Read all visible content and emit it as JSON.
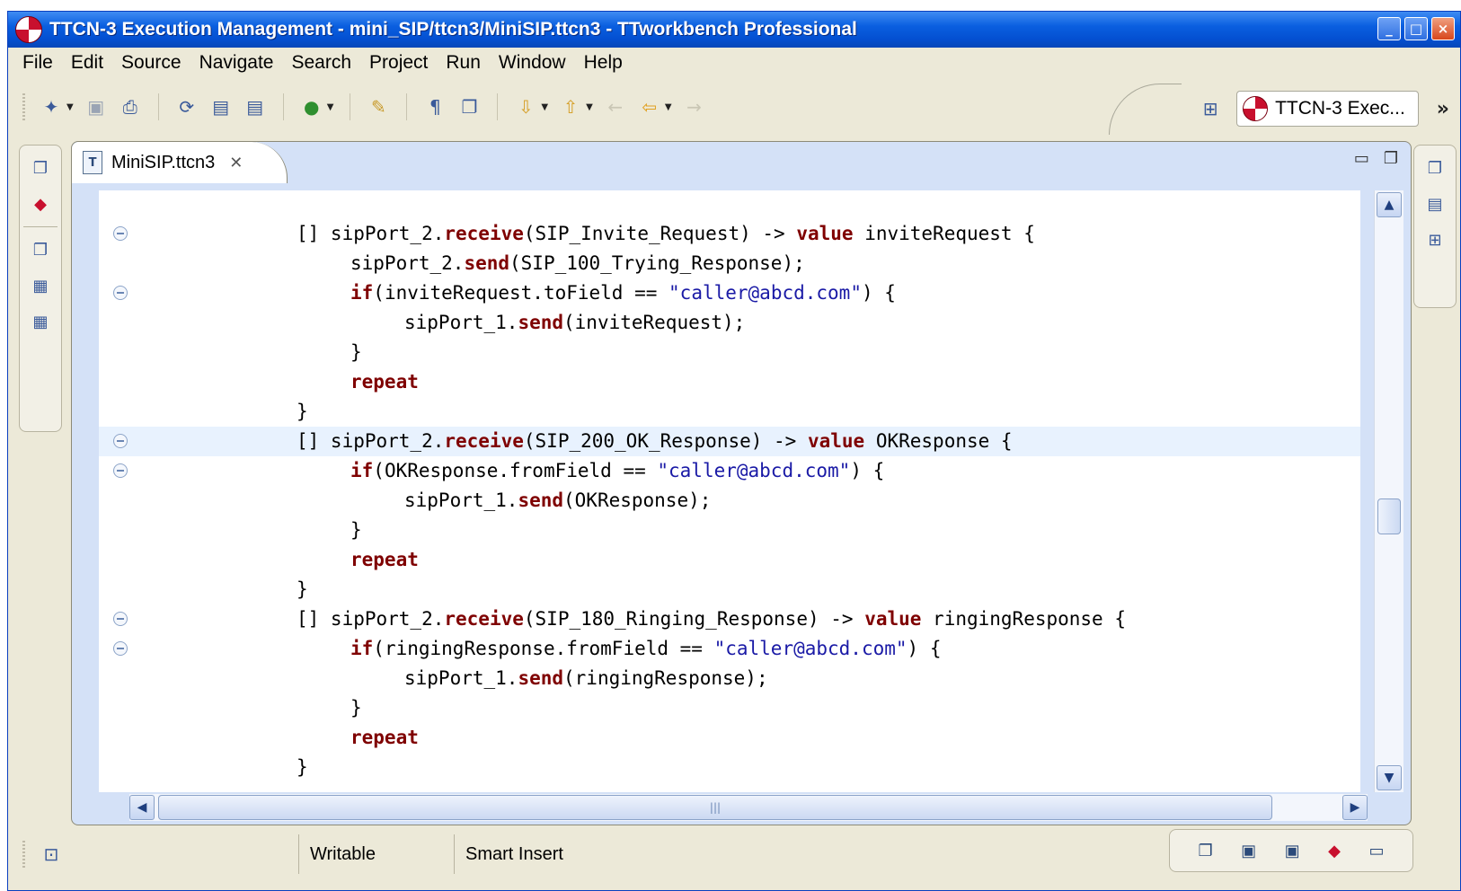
{
  "window": {
    "title": "TTCN-3 Execution Management - mini_SIP/ttcn3/MiniSIP.ttcn3 - TTworkbench Professional",
    "controls": [
      "_",
      "□",
      "×"
    ]
  },
  "menu": [
    "File",
    "Edit",
    "Source",
    "Navigate",
    "Search",
    "Project",
    "Run",
    "Window",
    "Help"
  ],
  "toolbar": {
    "icons": [
      "new-wizard-icon",
      "save-icon",
      "print-icon",
      "refresh-icon",
      "binary-icon",
      "binary-icon",
      "run-icon",
      "pencil-icon",
      "paragraph-icon",
      "copy-icon",
      "next-annotation-icon",
      "prev-annotation-icon",
      "back-icon",
      "back-icon",
      "forward-icon"
    ],
    "perspective_label": "TTCN-3 Exec...",
    "overflow": "»"
  },
  "editor": {
    "tab_label": "MiniSIP.ttcn3",
    "tab_icon": "T",
    "lines": [
      {
        "fold": true,
        "indent": 0,
        "tokens": [
          [
            "t",
            "[] sipPort_2."
          ],
          [
            "k",
            "receive"
          ],
          [
            "t",
            "(SIP_Invite_Request) -> "
          ],
          [
            "k",
            "value"
          ],
          [
            "t",
            " inviteRequest {"
          ]
        ]
      },
      {
        "fold": false,
        "indent": 1,
        "tokens": [
          [
            "t",
            "sipPort_2."
          ],
          [
            "k",
            "send"
          ],
          [
            "t",
            "(SIP_100_Trying_Response);"
          ]
        ]
      },
      {
        "fold": true,
        "indent": 1,
        "tokens": [
          [
            "k",
            "if"
          ],
          [
            "t",
            "(inviteRequest.toField == "
          ],
          [
            "s",
            "\"caller@abcd.com\""
          ],
          [
            "t",
            ") {"
          ]
        ]
      },
      {
        "fold": false,
        "indent": 2,
        "tokens": [
          [
            "t",
            "sipPort_1."
          ],
          [
            "k",
            "send"
          ],
          [
            "t",
            "(inviteRequest);"
          ]
        ]
      },
      {
        "fold": false,
        "indent": 1,
        "tokens": [
          [
            "t",
            "}"
          ]
        ]
      },
      {
        "fold": false,
        "indent": 1,
        "tokens": [
          [
            "k",
            "repeat"
          ]
        ]
      },
      {
        "fold": false,
        "indent": 0,
        "tokens": [
          [
            "t",
            "}"
          ]
        ]
      },
      {
        "fold": true,
        "indent": 0,
        "current": true,
        "tokens": [
          [
            "t",
            "[] sipPort_2."
          ],
          [
            "k",
            "receive"
          ],
          [
            "t",
            "(SIP_200_OK_Response) -> "
          ],
          [
            "k",
            "value"
          ],
          [
            "t",
            " OKResponse {"
          ]
        ]
      },
      {
        "fold": true,
        "indent": 1,
        "tokens": [
          [
            "k",
            "if"
          ],
          [
            "t",
            "(OKResponse.fromField == "
          ],
          [
            "s",
            "\"caller@abcd.com\""
          ],
          [
            "t",
            ") {"
          ]
        ]
      },
      {
        "fold": false,
        "indent": 2,
        "tokens": [
          [
            "t",
            "sipPort_1."
          ],
          [
            "k",
            "send"
          ],
          [
            "t",
            "(OKResponse);"
          ]
        ]
      },
      {
        "fold": false,
        "indent": 1,
        "tokens": [
          [
            "t",
            "}"
          ]
        ]
      },
      {
        "fold": false,
        "indent": 1,
        "tokens": [
          [
            "k",
            "repeat"
          ]
        ]
      },
      {
        "fold": false,
        "indent": 0,
        "tokens": [
          [
            "t",
            "}"
          ]
        ]
      },
      {
        "fold": true,
        "indent": 0,
        "tokens": [
          [
            "t",
            "[] sipPort_2."
          ],
          [
            "k",
            "receive"
          ],
          [
            "t",
            "(SIP_180_Ringing_Response) -> "
          ],
          [
            "k",
            "value"
          ],
          [
            "t",
            " ringingResponse {"
          ]
        ]
      },
      {
        "fold": true,
        "indent": 1,
        "tokens": [
          [
            "k",
            "if"
          ],
          [
            "t",
            "(ringingResponse.fromField == "
          ],
          [
            "s",
            "\"caller@abcd.com\""
          ],
          [
            "t",
            ") {"
          ]
        ]
      },
      {
        "fold": false,
        "indent": 2,
        "tokens": [
          [
            "t",
            "sipPort_1."
          ],
          [
            "k",
            "send"
          ],
          [
            "t",
            "(ringingResponse);"
          ]
        ]
      },
      {
        "fold": false,
        "indent": 1,
        "tokens": [
          [
            "t",
            "}"
          ]
        ]
      },
      {
        "fold": false,
        "indent": 1,
        "tokens": [
          [
            "k",
            "repeat"
          ]
        ]
      },
      {
        "fold": false,
        "indent": 0,
        "tokens": [
          [
            "t",
            "}"
          ]
        ]
      }
    ],
    "scroll_position": 0.55
  },
  "status": {
    "writable": "Writable",
    "insert_mode": "Smart Insert"
  },
  "colors": {
    "keyword": "#7f0000",
    "string": "#1a1aa6",
    "current_line": "#e8f2fe",
    "title_bar": "#0450d2"
  }
}
